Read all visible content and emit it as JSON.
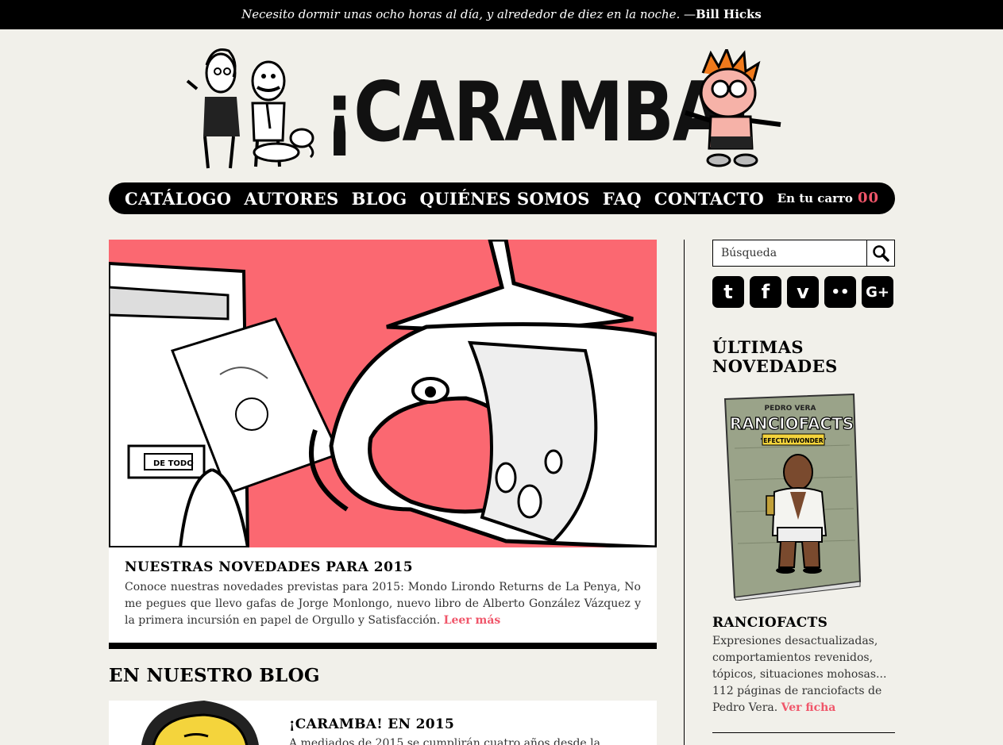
{
  "quote": {
    "text": "Necesito dormir unas ocho horas al día, y alrededor de diez en la noche. —",
    "author": "Bill Hicks"
  },
  "header": {
    "logo_text": "¡CARAMBA!"
  },
  "nav": {
    "items": [
      "CATÁLOGO",
      "AUTORES",
      "BLOG",
      "QUIÉNES SOMOS",
      "FAQ",
      "CONTACTO"
    ],
    "cart_label": "En tu carro",
    "cart_count": "00"
  },
  "feature": {
    "title": "NUESTRAS NOVEDADES PARA 2015",
    "text": "Conoce nuestras novedades previstas para 2015: Mondo Lirondo Returns de La Penya, No me pegues que llevo gafas de Jorge Monlongo, nuevo libro de Alberto González Vázquez y la primera incursión en papel de Orgullo y Satisfacción. ",
    "link": "Leer más",
    "art_text": "DE TODO"
  },
  "blog": {
    "heading": "EN NUESTRO BLOG",
    "post_title": "¡CARAMBA! EN 2015",
    "post_text": "A mediados de 2015 se cumplirán cuatro años desde la"
  },
  "sidebar": {
    "search_placeholder": "Búsqueda",
    "social": [
      {
        "icon": "twitter-icon",
        "glyph": "t"
      },
      {
        "icon": "facebook-icon",
        "glyph": "f"
      },
      {
        "icon": "vimeo-icon",
        "glyph": "v"
      },
      {
        "icon": "flickr-icon",
        "glyph": "••"
      },
      {
        "icon": "google-plus-icon",
        "glyph": "G+"
      }
    ],
    "heading": "ÚLTIMAS NOVEDADES",
    "book": {
      "author": "PEDRO VERA",
      "cover_title": "RANCIOFACTS",
      "cover_subtitle": "\"EFECTIVIWONDER\"",
      "title": "RANCIOFACTS",
      "desc": "Expresiones desactualizadas, comportamientos revenidos, tópicos, situaciones mohosas... 112 páginas de ranciofacts de Pedro Vera. ",
      "link": "Ver ficha"
    }
  },
  "colors": {
    "accent": "#f0566a",
    "feature_bg": "#fb6871",
    "page_bg": "#f1f0ea"
  }
}
